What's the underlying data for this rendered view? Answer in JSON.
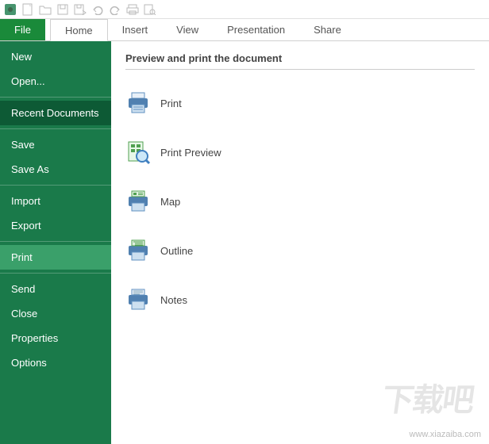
{
  "qat_icons": [
    "app",
    "new-file",
    "open",
    "save",
    "save-as",
    "undo",
    "redo",
    "print",
    "print-preview"
  ],
  "tabs": {
    "file": "File",
    "home": "Home",
    "insert": "Insert",
    "view": "View",
    "presentation": "Presentation",
    "share": "Share"
  },
  "sidebar": {
    "new": "New",
    "open": "Open...",
    "recent": "Recent Documents",
    "save": "Save",
    "saveas": "Save As",
    "import": "Import",
    "export": "Export",
    "print": "Print",
    "send": "Send",
    "close": "Close",
    "properties": "Properties",
    "options": "Options"
  },
  "content": {
    "title": "Preview and print the document",
    "items": {
      "print": "Print",
      "preview": "Print Preview",
      "map": "Map",
      "outline": "Outline",
      "notes": "Notes"
    }
  },
  "watermark": {
    "logo": "下载吧",
    "url": "www.xiazaiba.com"
  }
}
